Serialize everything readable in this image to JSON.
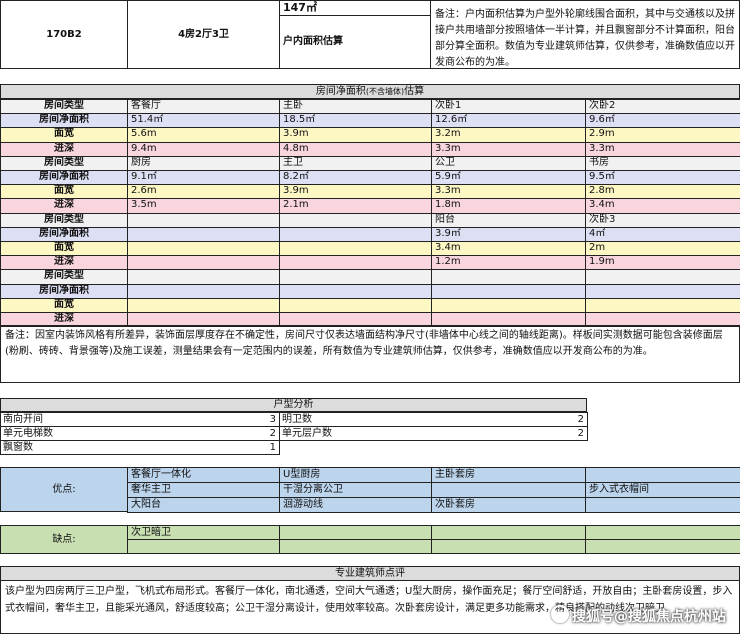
{
  "header": {
    "code": "170B2",
    "layout": "4房2厅3卫",
    "area": "147㎡",
    "area_label": "户内面积估算",
    "note": "备注：户内面积估算为户型外轮廓线围合面积，其中与交通核以及拼接户共用墙部分按照墙体一半计算，并且飘窗部分不计算面积，阳台部分算全面积。数值为专业建筑师估算，仅供参考，准确数值应以开发商公布的为准。"
  },
  "rooms": {
    "title": "房间净面积",
    "title_small": "(不含墙体)",
    "title_suffix": "估算",
    "row_labels": [
      "房间类型",
      "房间净面积",
      "面宽",
      "进深"
    ],
    "groups": [
      [
        {
          "name": "客餐厅",
          "area": "51.4㎡",
          "width": "5.6m",
          "depth": "9.4m"
        },
        {
          "name": "主卧",
          "area": "18.5㎡",
          "width": "3.9m",
          "depth": "4.8m"
        },
        {
          "name": "次卧1",
          "area": "12.6㎡",
          "width": "3.2m",
          "depth": "3.3m"
        },
        {
          "name": "次卧2",
          "area": "9.6㎡",
          "width": "2.9m",
          "depth": "3.3m"
        }
      ],
      [
        {
          "name": "厨房",
          "area": "9.1㎡",
          "width": "2.6m",
          "depth": "3.5m"
        },
        {
          "name": "主卫",
          "area": "8.2㎡",
          "width": "3.9m",
          "depth": "2.1m"
        },
        {
          "name": "公卫",
          "area": "5.9㎡",
          "width": "3.3m",
          "depth": "1.8m"
        },
        {
          "name": "书房",
          "area": "9.5㎡",
          "width": "2.8m",
          "depth": "3.4m"
        }
      ],
      [
        {
          "name": "",
          "area": "",
          "width": "",
          "depth": ""
        },
        {
          "name": "",
          "area": "",
          "width": "",
          "depth": ""
        },
        {
          "name": "阳台",
          "area": "3.9㎡",
          "width": "3.4m",
          "depth": "1.2m"
        },
        {
          "name": "次卧3",
          "area": "4㎡",
          "width": "2m",
          "depth": "1.9m"
        }
      ],
      [
        {
          "name": "",
          "area": "",
          "width": "",
          "depth": ""
        },
        {
          "name": "",
          "area": "",
          "width": "",
          "depth": ""
        },
        {
          "name": "",
          "area": "",
          "width": "",
          "depth": ""
        },
        {
          "name": "",
          "area": "",
          "width": "",
          "depth": ""
        }
      ]
    ],
    "note": "备注：因室内装饰风格有所差异，装饰面层厚度存在不确定性，房间尺寸仅表达墙面结构净尺寸(非墙体中心线之间的轴线距离)。样板间实测数据可能包含装修面层(粉刷、砖砖、背景强等)及施工误差，测量结果会有一定范围内的误差，所有数值为专业建筑师估算，仅供参考，准确数值应以开发商公布的为准。"
  },
  "analysis": {
    "title": "户型分析",
    "rows": [
      {
        "l1": "南向开间",
        "v1": "3",
        "l2": "明卫数",
        "v2": "2"
      },
      {
        "l1": "单元电梯数",
        "v1": "2",
        "l2": "单元层户数",
        "v2": "2"
      },
      {
        "l1": "飘窗数",
        "v1": "1",
        "l2": "",
        "v2": ""
      }
    ]
  },
  "pros": {
    "label": "优点:",
    "items": [
      "客餐厅一体化",
      "U型厨房",
      "主卧套房",
      "",
      "奢华主卫",
      "干湿分离公卫",
      "",
      "步入式衣帽间",
      "大阳台",
      "洄游动线",
      "次卧套房",
      ""
    ]
  },
  "cons": {
    "label": "缺点:",
    "items": [
      "次卫暗卫",
      "",
      "",
      "",
      "",
      "",
      "",
      ""
    ]
  },
  "review": {
    "title": "专业建筑师点评",
    "text": "该户型为四房两厅三卫户型，飞机式布局形式。客餐厅一体化，南北通透，空间大气通透；U型大厨房，操作面充足；餐厅空间舒适，开放自由；主卧套房设置，步入式衣帽间，奢华主卫，且能采光通风，舒适度较高；公卫干湿分离设计，使用效率较高。次卧套房设计，满足更多功能需求，精良搭配的动线次卫暗卫"
  },
  "watermark": "搜狐号@搜狐焦点杭州站"
}
